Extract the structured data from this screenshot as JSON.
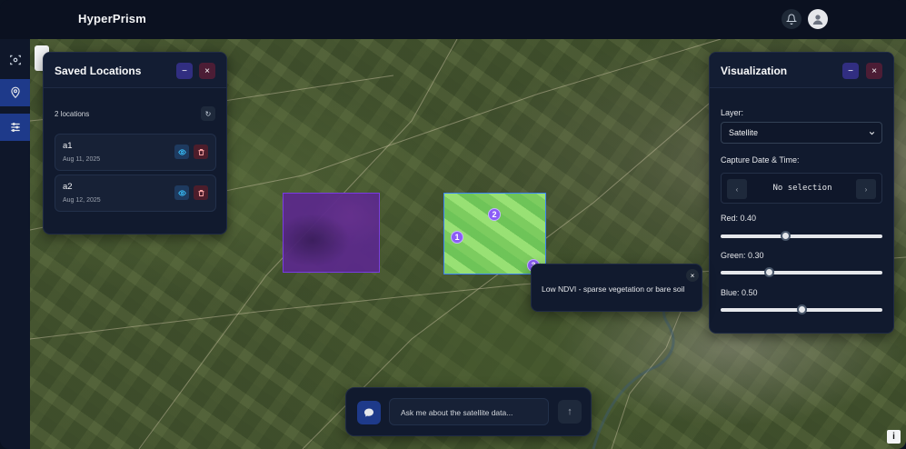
{
  "app": {
    "title": "HyperPrism"
  },
  "header": {
    "notifications_icon": "bell-icon",
    "user_icon": "user-avatar-icon"
  },
  "rail": {
    "items": [
      {
        "icon": "scan-target-icon"
      },
      {
        "icon": "map-pin-icon",
        "active": true
      },
      {
        "icon": "sliders-icon",
        "active": true
      }
    ]
  },
  "saved_locations": {
    "title": "Saved Locations",
    "count_text": "2 locations",
    "items": [
      {
        "name": "a1",
        "date": "Aug 11, 2025"
      },
      {
        "name": "a2",
        "date": "Aug 12, 2025"
      }
    ]
  },
  "map": {
    "markers": [
      "1",
      "2",
      "3"
    ],
    "tooltip": "Low NDVI - sparse vegetation or bare soil"
  },
  "visualization": {
    "title": "Visualization",
    "layer_label": "Layer:",
    "layer_value": "Satellite",
    "capture_label": "Capture Date & Time:",
    "capture_value": "No selection",
    "prev_symbol": "‹",
    "next_symbol": "›",
    "red_label": "Red: 0.40",
    "green_label": "Green: 0.30",
    "blue_label": "Blue: 0.50",
    "red": 0.4,
    "green": 0.3,
    "blue": 0.5
  },
  "chat": {
    "placeholder": "Ask me about the satellite data...",
    "send_symbol": "↑"
  },
  "info_symbol": "i",
  "colors": {
    "accent": "#8b5cf6",
    "panel": "#111a2e",
    "active_rail": "#1e3a8a"
  }
}
